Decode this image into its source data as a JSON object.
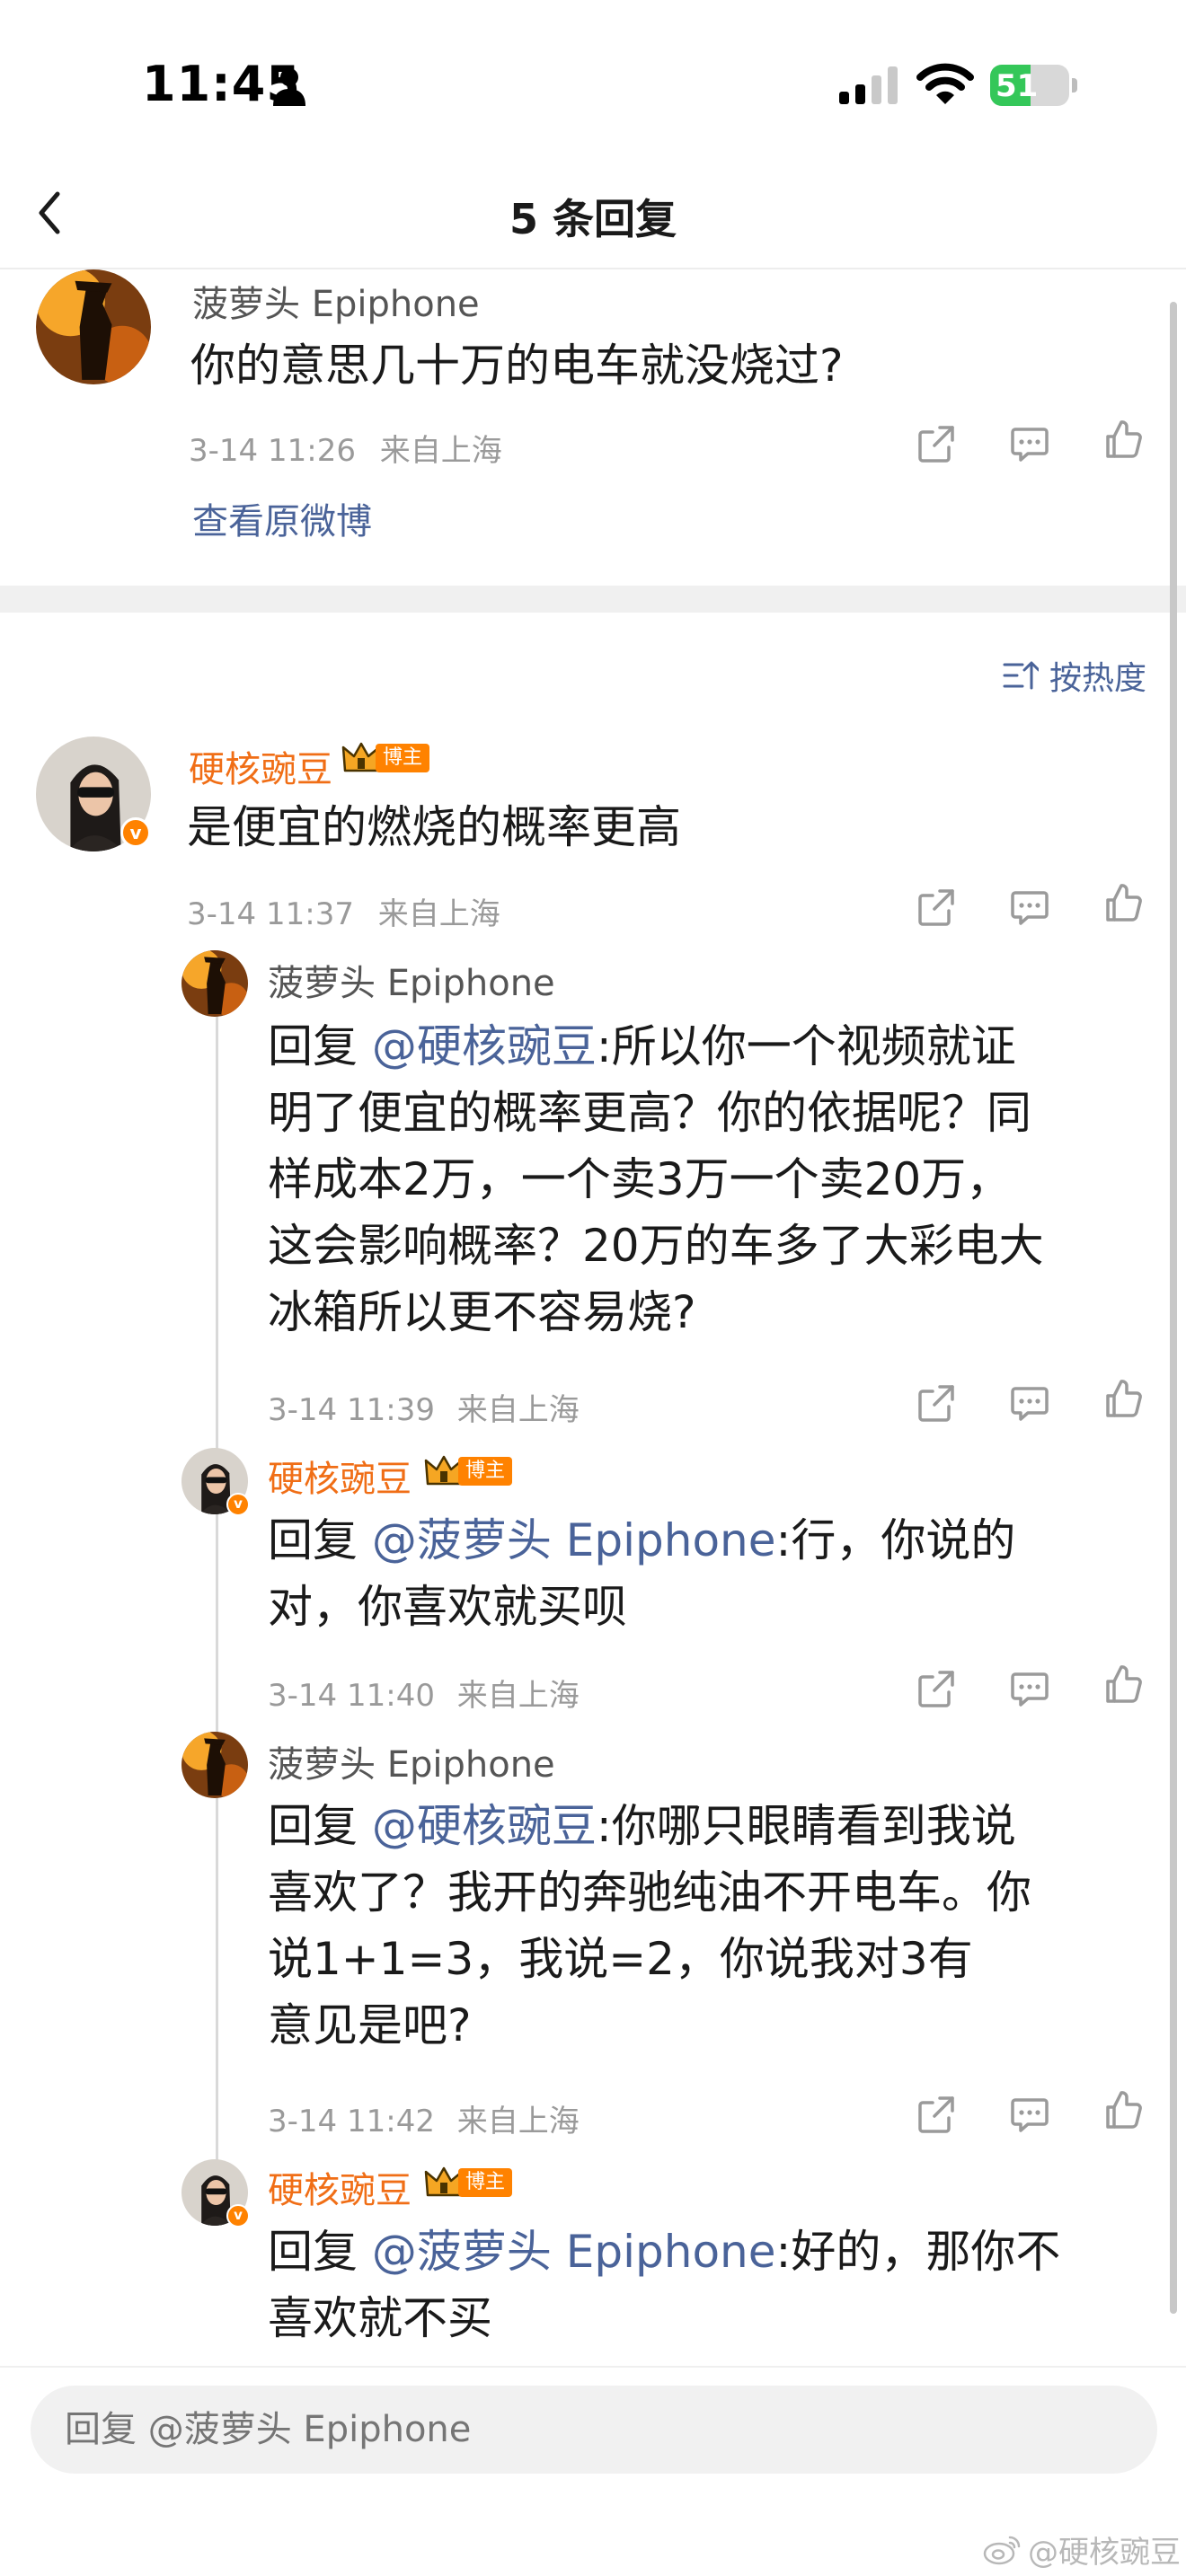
{
  "status_bar": {
    "time": "11:45",
    "battery_level": "51",
    "battery_fraction": 0.51
  },
  "header": {
    "title": "5 条回复"
  },
  "root_comment": {
    "username": "菠萝头 Epiphone",
    "text": "你的意思几十万的电车就没烧过?",
    "time": "3-14 11:26",
    "location": "来自上海",
    "view_original": "查看原微博"
  },
  "sort": {
    "label": "按热度"
  },
  "reply": {
    "username": "硬核豌豆",
    "badge": "博主",
    "text": "是便宜的燃烧的概率更高",
    "time": "3-14 11:37",
    "location": "来自上海"
  },
  "sub_replies": [
    {
      "username": "菠萝头 Epiphone",
      "prefix": "回复 ",
      "mention": "@硬核豌豆",
      "lines": [
        ":所以你一个视频就证",
        "明了便宜的概率更高？你的依据呢？同",
        "样成本2万，一个卖3万一个卖20万，",
        "这会影响概率？20万的车多了大彩电大",
        "冰箱所以更不容易烧?"
      ],
      "time": "3-14 11:39",
      "location": "来自上海"
    },
    {
      "username": "硬核豌豆",
      "badge": "博主",
      "prefix": "回复 ",
      "mention": "@菠萝头 Epiphone",
      "lines": [
        ":行，你说的",
        "对，你喜欢就买呗"
      ],
      "time": "3-14 11:40",
      "location": "来自上海"
    },
    {
      "username": "菠萝头 Epiphone",
      "prefix": "回复 ",
      "mention": "@硬核豌豆",
      "lines": [
        ":你哪只眼睛看到我说",
        "喜欢了？我开的奔驰纯油不开电车。你",
        "说1+1=3，我说=2，你说我对3有",
        "意见是吧?"
      ],
      "time": "3-14 11:42",
      "location": "来自上海"
    },
    {
      "username": "硬核豌豆",
      "badge": "博主",
      "prefix": "回复 ",
      "mention": "@菠萝头 Epiphone",
      "lines": [
        ":好的，那你不",
        "喜欢就不买"
      ]
    }
  ],
  "input": {
    "placeholder": "回复 @菠萝头 Epiphone"
  },
  "watermark": "@硬核豌豆",
  "colors": {
    "link": "#4a6399",
    "blogger_name": "#f06e16",
    "badge": "#ff8200",
    "meta": "#9a9a9a",
    "battery": "#34c759"
  }
}
